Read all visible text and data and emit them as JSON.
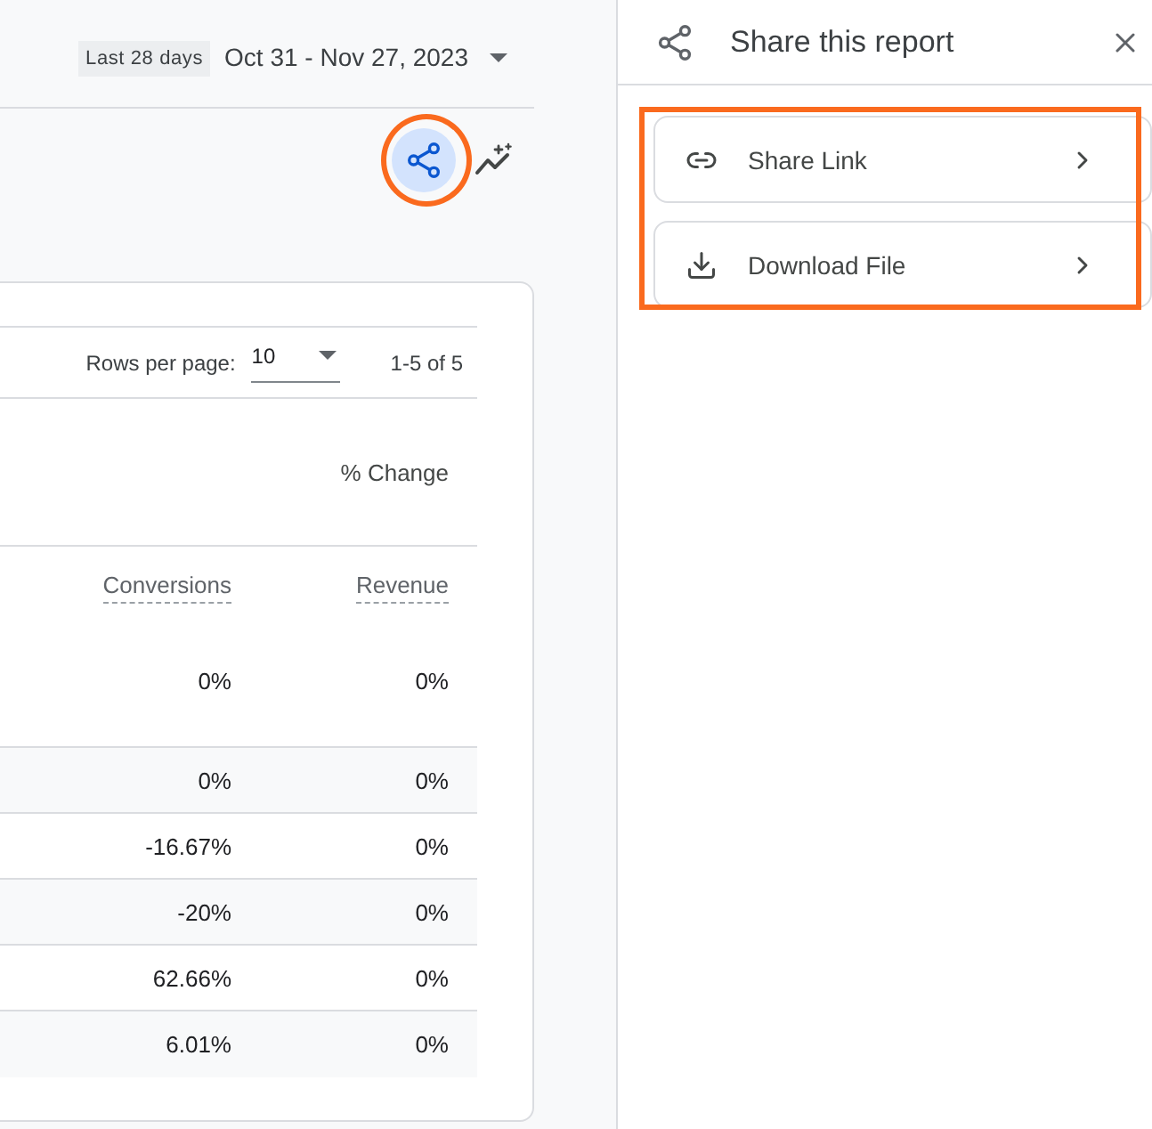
{
  "date_range": {
    "preset": "Last 28 days",
    "range": "Oct 31 - Nov 27, 2023"
  },
  "toolbar": {
    "share_button": {
      "active": true,
      "highlighted": true
    }
  },
  "table": {
    "pagination": {
      "rows_per_page_label": "Rows per page:",
      "rows_per_page": "10",
      "range": "1-5 of 5"
    },
    "group_header": "% Change",
    "columns": [
      {
        "label": "Conversions",
        "total": "0%"
      },
      {
        "label": "Revenue",
        "total": "0%"
      }
    ],
    "rows": [
      [
        "0%",
        "0%"
      ],
      [
        "-16.67%",
        "0%"
      ],
      [
        "-20%",
        "0%"
      ],
      [
        "62.66%",
        "0%"
      ],
      [
        "6.01%",
        "0%"
      ]
    ]
  },
  "share_panel": {
    "title": "Share this report",
    "highlighted": true,
    "options": [
      {
        "kind": "link",
        "label": "Share Link"
      },
      {
        "kind": "download",
        "label": "Download File"
      }
    ]
  }
}
